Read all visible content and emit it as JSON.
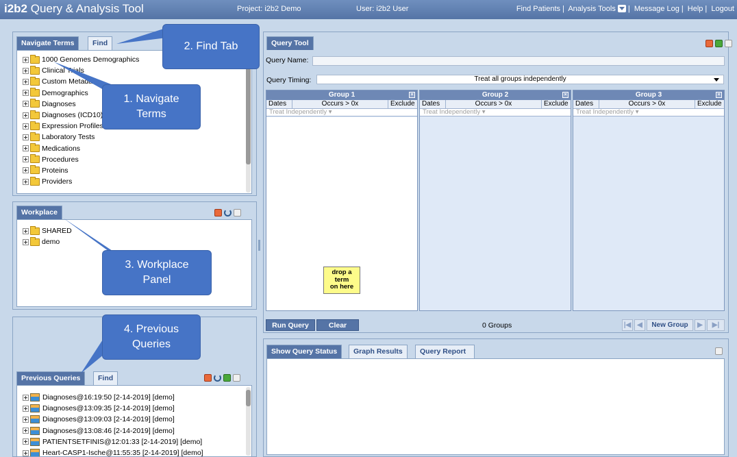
{
  "header": {
    "app_name_bold": "i2b2",
    "app_name_rest": "Query & Analysis Tool",
    "project": "Project: i2b2 Demo",
    "user": "User: i2b2 User",
    "nav": [
      "Find Patients",
      "Analysis Tools",
      "Message Log",
      "Help",
      "Logout"
    ]
  },
  "navigate": {
    "tabs": [
      "Navigate Terms",
      "Find"
    ],
    "items": [
      "1000 Genomes Demographics",
      "Clinical Trials",
      "Custom Metadata",
      "Demographics",
      "Diagnoses",
      "Diagnoses (ICD10)",
      "Expression Profiles",
      "Laboratory Tests",
      "Medications",
      "Procedures",
      "Proteins",
      "Providers"
    ]
  },
  "workplace": {
    "tab": "Workplace",
    "items": [
      "SHARED",
      "demo"
    ]
  },
  "previous": {
    "tabs": [
      "Previous Queries",
      "Find"
    ],
    "items": [
      "Diagnoses@16:19:50 [2-14-2019] [demo]",
      "Diagnoses@13:09:35 [2-14-2019] [demo]",
      "Diagnoses@13:09:03 [2-14-2019] [demo]",
      "Diagnoses@13:08:46 [2-14-2019] [demo]",
      "PATIENTSETFINIS@12:01:33 [2-14-2019] [demo]",
      "Heart-CASP1-Ische@11:55:35 [2-14-2019] [demo]"
    ]
  },
  "callouts": {
    "find_tab": "2. Find Tab",
    "navigate_terms": "1. Navigate\nTerms",
    "workplace": "3.  Workplace\nPanel",
    "previous": "4.  Previous\nQueries"
  },
  "query_tool": {
    "tab": "Query Tool",
    "name_label": "Query Name:",
    "name_value": "",
    "timing_label": "Query Timing:",
    "timing_value": "Treat all groups independently",
    "groups": [
      {
        "title": "Group 1",
        "dates": "Dates",
        "occurs": "Occurs > 0x",
        "exclude": "Exclude",
        "timing": "Treat Independently"
      },
      {
        "title": "Group 2",
        "dates": "Dates",
        "occurs": "Occurs > 0x",
        "exclude": "Exclude",
        "timing": "Treat Independently"
      },
      {
        "title": "Group 3",
        "dates": "Dates",
        "occurs": "Occurs > 0x",
        "exclude": "Exclude",
        "timing": "Treat Independently"
      }
    ],
    "drop_note": "drop a\nterm\non here",
    "run_label": "Run Query",
    "clear_label": "Clear",
    "group_count": "0 Groups",
    "new_group_label": "New Group"
  },
  "status": {
    "tabs": [
      "Show Query Status",
      "Graph Results",
      "Query Report"
    ]
  }
}
